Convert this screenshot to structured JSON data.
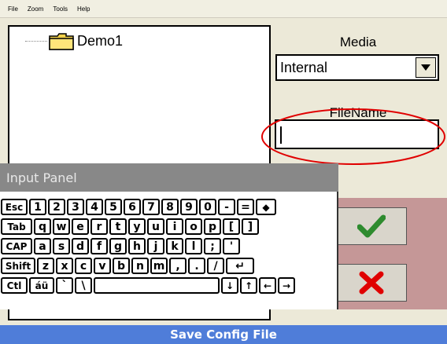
{
  "menu": [
    "File",
    "Zoom",
    "Tools",
    "Help"
  ],
  "tree": {
    "items": [
      {
        "label": "Demo1",
        "icon": "folder-icon"
      }
    ]
  },
  "media": {
    "label": "Media",
    "value": "Internal"
  },
  "filename": {
    "label": "FileName",
    "value": ""
  },
  "buttons": {
    "ok_icon": "checkmark-icon",
    "cancel_icon": "x-icon"
  },
  "input_panel": {
    "title": "Input Panel",
    "rows": [
      [
        "Esc",
        "1",
        "2",
        "3",
        "4",
        "5",
        "6",
        "7",
        "8",
        "9",
        "0",
        "-",
        "=",
        "◆"
      ],
      [
        "Tab",
        "q",
        "w",
        "e",
        "r",
        "t",
        "y",
        "u",
        "i",
        "o",
        "p",
        "[",
        "]"
      ],
      [
        "CAP",
        "a",
        "s",
        "d",
        "f",
        "g",
        "h",
        "j",
        "k",
        "l",
        ";",
        "'"
      ],
      [
        "Shift",
        "z",
        "x",
        "c",
        "v",
        "b",
        "n",
        "m",
        ",",
        ".",
        "/",
        "↵"
      ],
      [
        "Ctl",
        "áü",
        "`",
        "\\",
        " ",
        "↓",
        "↑",
        "←",
        "→"
      ]
    ]
  },
  "status": {
    "text": "Save Config File"
  },
  "colors": {
    "status_bar": "#4F7DD9",
    "button_area": "#C59797",
    "ok": "#2E8B2E",
    "cancel": "#E00000",
    "highlight_ellipse": "#E00000"
  }
}
